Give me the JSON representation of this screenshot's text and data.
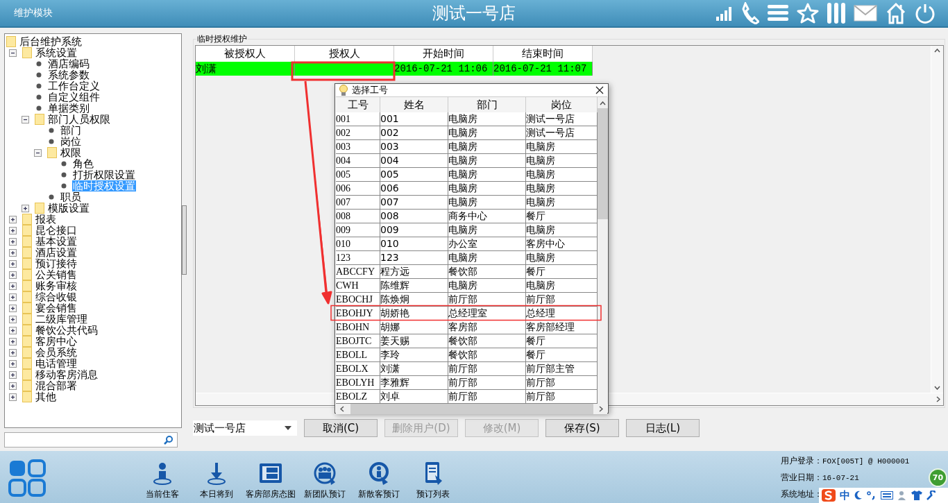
{
  "header": {
    "module": "维护模块",
    "store": "测试一号店"
  },
  "tree": {
    "label": "后台维护系统",
    "kind": "root",
    "selected": false,
    "children": [
      {
        "label": "系统设置",
        "kind": "folder",
        "expanded": true,
        "selected": false,
        "children": [
          {
            "label": "酒店编码",
            "kind": "leaf",
            "selected": false
          },
          {
            "label": "系统参数",
            "kind": "leaf",
            "selected": false
          },
          {
            "label": "工作台定义",
            "kind": "leaf",
            "selected": false
          },
          {
            "label": "自定义组件",
            "kind": "leaf",
            "selected": false
          },
          {
            "label": "单据类别",
            "kind": "leaf",
            "selected": false
          },
          {
            "label": "部门人员权限",
            "kind": "folder",
            "expanded": true,
            "selected": false,
            "children": [
              {
                "label": "部门",
                "kind": "leaf",
                "selected": false
              },
              {
                "label": "岗位",
                "kind": "leaf",
                "selected": false
              },
              {
                "label": "权限",
                "kind": "folder",
                "expanded": true,
                "selected": false,
                "children": [
                  {
                    "label": "角色",
                    "kind": "leaf",
                    "selected": false
                  },
                  {
                    "label": "打折权限设置",
                    "kind": "leaf",
                    "selected": false
                  },
                  {
                    "label": "临时授权设置",
                    "kind": "leaf",
                    "selected": true
                  }
                ]
              },
              {
                "label": "职员",
                "kind": "leaf",
                "selected": false
              }
            ]
          },
          {
            "label": "模版设置",
            "kind": "folder",
            "expanded": false,
            "selected": false
          }
        ]
      },
      {
        "label": "报表",
        "kind": "folder",
        "expanded": false,
        "selected": false
      },
      {
        "label": "昆仑接口",
        "kind": "folder",
        "expanded": false,
        "selected": false
      },
      {
        "label": "基本设置",
        "kind": "folder",
        "expanded": false,
        "selected": false
      },
      {
        "label": "酒店设置",
        "kind": "folder",
        "expanded": false,
        "selected": false
      },
      {
        "label": "预订接待",
        "kind": "folder",
        "expanded": false,
        "selected": false
      },
      {
        "label": "公关销售",
        "kind": "folder",
        "expanded": false,
        "selected": false
      },
      {
        "label": "账务审核",
        "kind": "folder",
        "expanded": false,
        "selected": false
      },
      {
        "label": "综合收银",
        "kind": "folder",
        "expanded": false,
        "selected": false
      },
      {
        "label": "宴会销售",
        "kind": "folder",
        "expanded": false,
        "selected": false
      },
      {
        "label": "二级库管理",
        "kind": "folder",
        "expanded": false,
        "selected": false
      },
      {
        "label": "餐饮公共代码",
        "kind": "folder",
        "expanded": false,
        "selected": false
      },
      {
        "label": "客房中心",
        "kind": "folder",
        "expanded": false,
        "selected": false
      },
      {
        "label": "会员系统",
        "kind": "folder",
        "expanded": false,
        "selected": false
      },
      {
        "label": "电话管理",
        "kind": "folder",
        "expanded": false,
        "selected": false
      },
      {
        "label": "移动客房消息",
        "kind": "folder",
        "expanded": false,
        "selected": false
      },
      {
        "label": "混合部署",
        "kind": "folder",
        "expanded": false,
        "selected": false
      },
      {
        "label": "其他",
        "kind": "folder",
        "expanded": false,
        "selected": false
      }
    ]
  },
  "panel": {
    "title": "临时授权维护",
    "columns": [
      "被授权人",
      "授权人",
      "开始时间",
      "结束时间"
    ],
    "rows": [
      {
        "grantee": "刘潇",
        "start": "2016-07-21 11:06",
        "end": "2016-07-21 11:07",
        "selected": true
      }
    ]
  },
  "store_select": {
    "value": "测试一号店"
  },
  "buttons": [
    {
      "label": "取消(C)",
      "disabled": false
    },
    {
      "label": "删除用户(D)",
      "disabled": true
    },
    {
      "label": "修改(M)",
      "disabled": true
    },
    {
      "label": "保存(S)",
      "disabled": false
    },
    {
      "label": "日志(L)",
      "disabled": false
    }
  ],
  "dialog": {
    "title": "选择工号",
    "columns": [
      "工号",
      "姓名",
      "部门",
      "岗位"
    ],
    "rows": [
      [
        "001",
        "001",
        "电脑房",
        "测试一号店"
      ],
      [
        "002",
        "002",
        "电脑房",
        "测试一号店"
      ],
      [
        "003",
        "003",
        "电脑房",
        "电脑房"
      ],
      [
        "004",
        "004",
        "电脑房",
        "电脑房"
      ],
      [
        "005",
        "005",
        "电脑房",
        "电脑房"
      ],
      [
        "006",
        "006",
        "电脑房",
        "电脑房"
      ],
      [
        "007",
        "007",
        "电脑房",
        "电脑房"
      ],
      [
        "008",
        "008",
        "商务中心",
        "餐厅"
      ],
      [
        "009",
        "009",
        "电脑房",
        "电脑房"
      ],
      [
        "010",
        "010",
        "办公室",
        "客房中心"
      ],
      [
        "123",
        "123",
        "电脑房",
        "电脑房"
      ],
      [
        "ABCCFY",
        "程方远",
        "餐饮部",
        "餐厅"
      ],
      [
        "CWH",
        "陈维辉",
        "电脑房",
        "电脑房"
      ],
      [
        "EBOCHJ",
        "陈焕炯",
        "前厅部",
        "前厅部"
      ],
      [
        "EBOHJY",
        "胡娇艳",
        "总经理室",
        "总经理"
      ],
      [
        "EBOHN",
        "胡娜",
        "客房部",
        "客房部经理"
      ],
      [
        "EBOJTC",
        "姜天赐",
        "餐饮部",
        "餐厅"
      ],
      [
        "EBOLL",
        "李玲",
        "餐饮部",
        "餐厅"
      ],
      [
        "EBOLX",
        "刘潇",
        "前厅部",
        "前厅部主管"
      ],
      [
        "EBOLYH",
        "李雅辉",
        "前厅部",
        "前厅部"
      ],
      [
        "EBOLZ",
        "刘卓",
        "前厅部",
        "前厅部"
      ]
    ]
  },
  "toolbar": [
    {
      "label": "当前住客",
      "kind": "guest"
    },
    {
      "label": "本日将到",
      "kind": "arrival"
    },
    {
      "label": "客房部房态图",
      "kind": "roommap"
    },
    {
      "label": "新团队预订",
      "kind": "group"
    },
    {
      "label": "新散客预订",
      "kind": "single"
    },
    {
      "label": "预订列表",
      "kind": "list"
    }
  ],
  "status": [
    {
      "label": "用户登录：",
      "value": "FOX[005T] @ H000001"
    },
    {
      "label": "营业日期：",
      "value": "16-07-21"
    },
    {
      "label": "系统地址："
    }
  ],
  "ime": {
    "mode": "中"
  },
  "badge": "70"
}
